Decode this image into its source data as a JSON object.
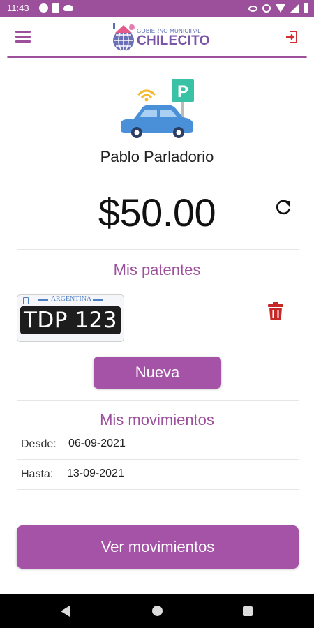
{
  "status_bar": {
    "time": "11:43",
    "icons_left": [
      "notification-icon",
      "sim-icon",
      "cloud-icon"
    ],
    "icons_right": [
      "eye-icon",
      "circle-icon",
      "wifi-icon",
      "signal-icon",
      "battery-icon"
    ]
  },
  "header": {
    "logo_small": "GOBIERNO MUNICIPAL",
    "logo_big": "CHILECITO",
    "menu_icon": "hamburger-menu-icon",
    "logout_icon": "logout-icon"
  },
  "user": {
    "name": "Pablo Parladorio",
    "balance": "$50.00"
  },
  "patentes": {
    "title": "Mis patentes",
    "plates": [
      {
        "country": "ARGENTINA",
        "number": "TDP 123"
      }
    ],
    "new_button": "Nueva"
  },
  "movimientos": {
    "title": "Mis movimientos",
    "desde_label": "Desde:",
    "desde_value": "06-09-2021",
    "hasta_label": "Hasta:",
    "hasta_value": "13-09-2021",
    "button": "Ver movimientos"
  },
  "colors": {
    "primary": "#9c4f9b",
    "button": "#a553a7",
    "delete": "#c62828",
    "plate_blue": "#4e7fc2"
  }
}
